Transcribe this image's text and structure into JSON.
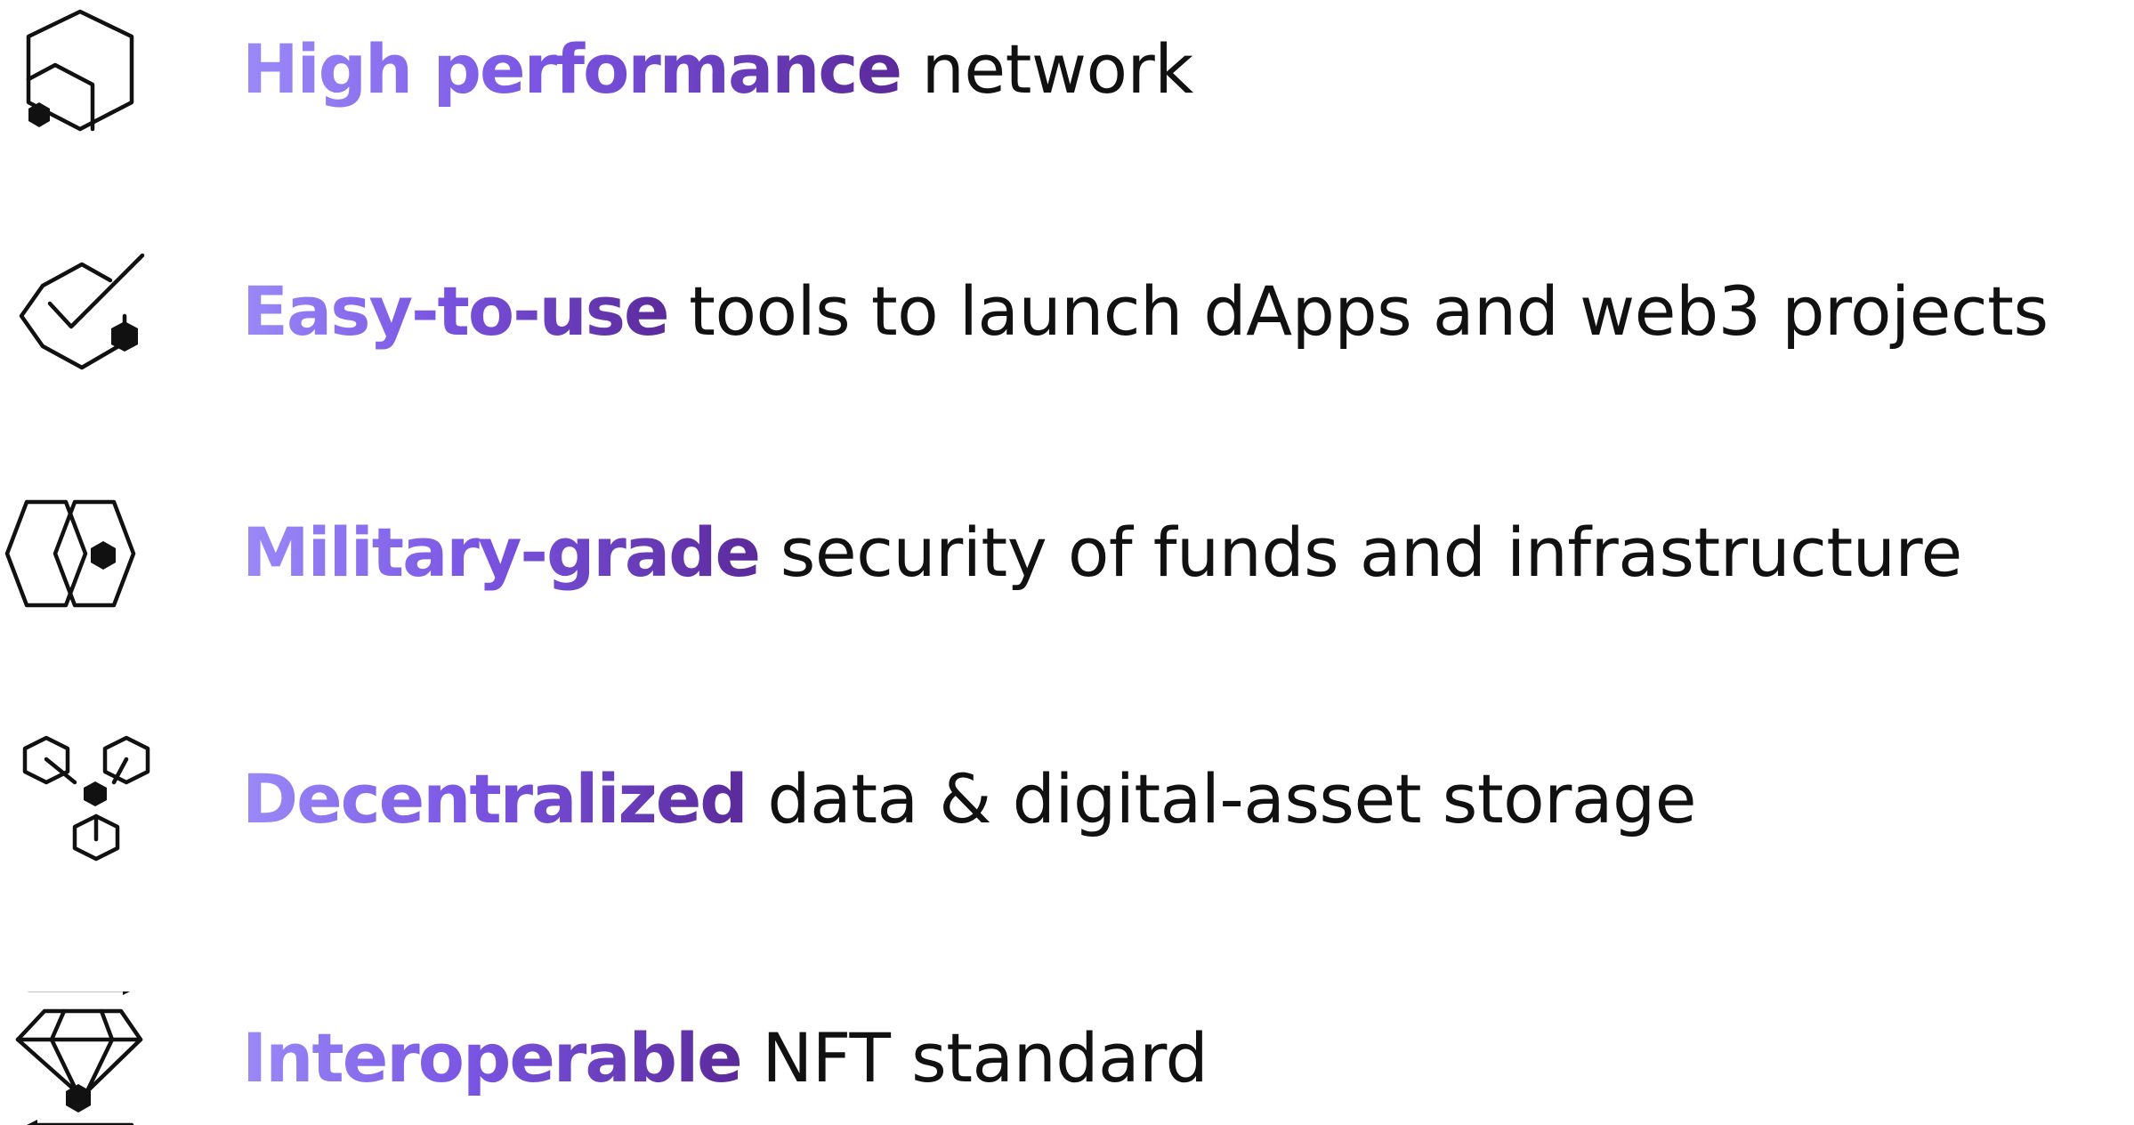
{
  "features": [
    {
      "icon": "performance-hexagon-icon",
      "highlight": "High performance",
      "text": " network"
    },
    {
      "icon": "checkmark-hexagon-icon",
      "highlight": "Easy-to-use",
      "text": " tools to launch dApps and web3 projects"
    },
    {
      "icon": "interlocked-hexagons-icon",
      "highlight": "Military-grade",
      "text": " security of funds and infrastructure"
    },
    {
      "icon": "distributed-nodes-icon",
      "highlight": "Decentralized",
      "text": " data & digital-asset storage"
    },
    {
      "icon": "gem-transfer-icon",
      "highlight": "Interoperable",
      "text": " NFT standard"
    }
  ],
  "colors": {
    "highlight_gradient_start": "#9b8af8",
    "highlight_gradient_mid": "#7a55e3",
    "highlight_gradient_end": "#5b2a9a",
    "text": "#111111",
    "background": "#ffffff"
  }
}
